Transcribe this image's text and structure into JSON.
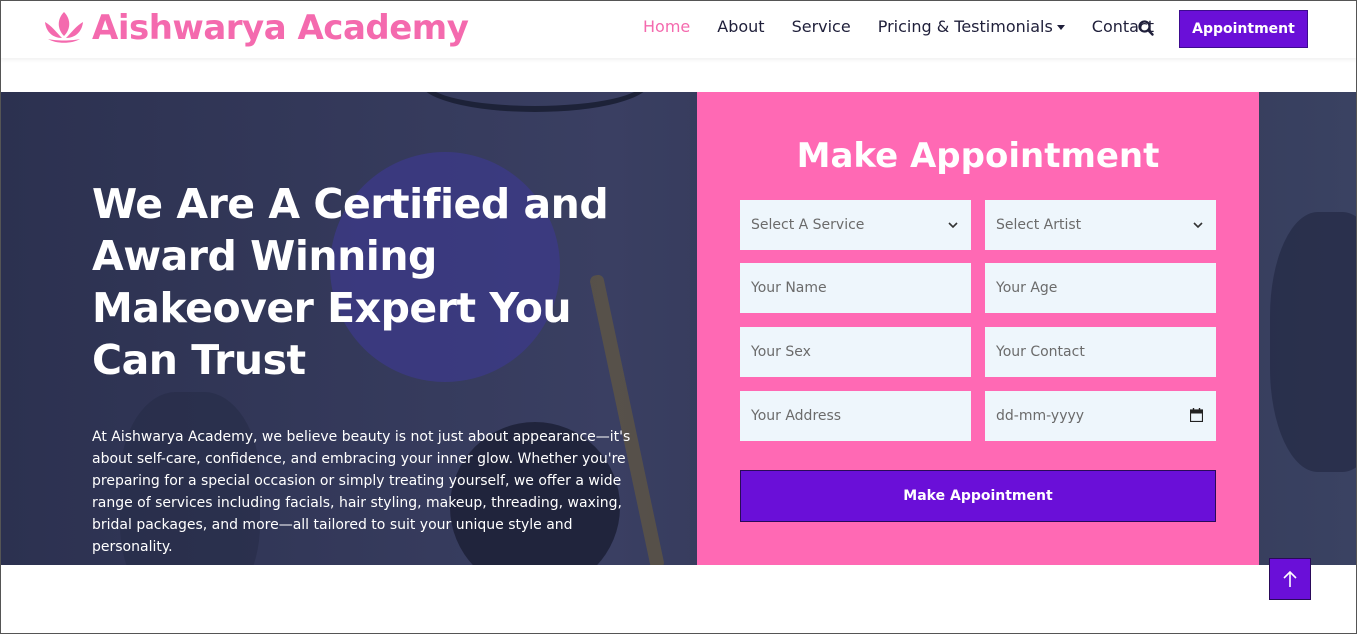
{
  "brand": {
    "name": "Aishwarya Academy",
    "icon": "lotus-icon",
    "color": "#f46aae"
  },
  "nav": {
    "items": [
      {
        "label": "Home",
        "active": true
      },
      {
        "label": "About"
      },
      {
        "label": "Service"
      },
      {
        "label": "Pricing & Testimonials",
        "dropdown": true
      },
      {
        "label": "Contact"
      }
    ],
    "search_icon": "search-icon",
    "cta_label": "Appointment"
  },
  "hero": {
    "title": "We Are A Certified and Award Winning Makeover Expert You Can Trust",
    "description": "At Aishwarya Academy, we believe beauty is not just about appearance—it's about self-care, confidence, and embracing your inner glow. Whether you're preparing for a special occasion or simply treating yourself, we offer a wide range of services including facials, hair styling, makeup, threading, waxing, bridal packages, and more—all tailored to suit your unique style and personality."
  },
  "form": {
    "title": "Make Appointment",
    "service_select": "Select A Service",
    "artist_select": "Select Artist",
    "name_placeholder": "Your Name",
    "age_placeholder": "Your Age",
    "sex_placeholder": "Your Sex",
    "contact_placeholder": "Your Contact",
    "address_placeholder": "Your Address",
    "date_placeholder": "dd-mm-yyyy",
    "submit_label": "Make Appointment",
    "panel_color": "#ff69b4",
    "field_color": "#eef6fc",
    "button_color": "#6a0fd8"
  },
  "back_to_top": {
    "icon": "arrow-up-icon"
  }
}
